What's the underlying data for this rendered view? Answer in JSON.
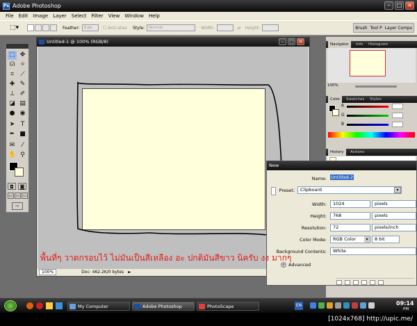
{
  "window": {
    "title": "Adobe Photoshop"
  },
  "menu": [
    "File",
    "Edit",
    "Image",
    "Layer",
    "Select",
    "Filter",
    "View",
    "Window",
    "Help"
  ],
  "options": {
    "feather_label": "Feather:",
    "feather_value": "0 px",
    "antialias_label": "Anti-alias",
    "style_label": "Style:",
    "style_value": "Normal",
    "width_label": "Width:",
    "height_label": "Height:",
    "palette_tabs": [
      "Brush",
      "Tool P",
      "Layer Comps"
    ]
  },
  "document": {
    "title": "Untitled-1 @ 100% (RGB/8)",
    "zoom": "100%",
    "doc_info": "Doc: 462.2K/0 bytes"
  },
  "panels": {
    "navigator_tabs": [
      "Navigator",
      "Info",
      "Histogram"
    ],
    "navigator_zoom": "100%",
    "color_tabs": [
      "Color",
      "Swatches",
      "Styles"
    ],
    "color_channels": [
      "R",
      "G",
      "B"
    ],
    "history_tabs": [
      "History",
      "Actions"
    ]
  },
  "dialog": {
    "title": "New",
    "name_label": "Name:",
    "name_value": "Untitled-2",
    "preset_label": "Preset:",
    "preset_value": "Clipboard",
    "width_label": "Width:",
    "width_value": "1024",
    "width_unit": "pixels",
    "height_label": "Height:",
    "height_value": "768",
    "height_unit": "pixels",
    "resolution_label": "Resolution:",
    "resolution_value": "72",
    "resolution_unit": "pixels/inch",
    "color_mode_label": "Color Mode:",
    "color_mode_value": "RGB Color",
    "bit_value": "8 bit",
    "background_label": "Background Contents:",
    "background_value": "White",
    "advanced_label": "Advanced"
  },
  "caption": "พื้นที่ๆ วาดกรอบไว้ ไม่มันเป็นสีเหลือง อะ ปกติมันสีขาว นิครับ งง มากๆ",
  "taskbar": {
    "buttons": [
      "My Computer",
      "Adobe Photoshop",
      "PhotoScape"
    ],
    "lang": "EN",
    "clock_time": "09:14",
    "clock_ampm": "PM"
  },
  "footer": "[1024x768] http://upic.me/",
  "colors": {
    "canvas": "#ffffdc",
    "caption": "#e31c1c"
  }
}
